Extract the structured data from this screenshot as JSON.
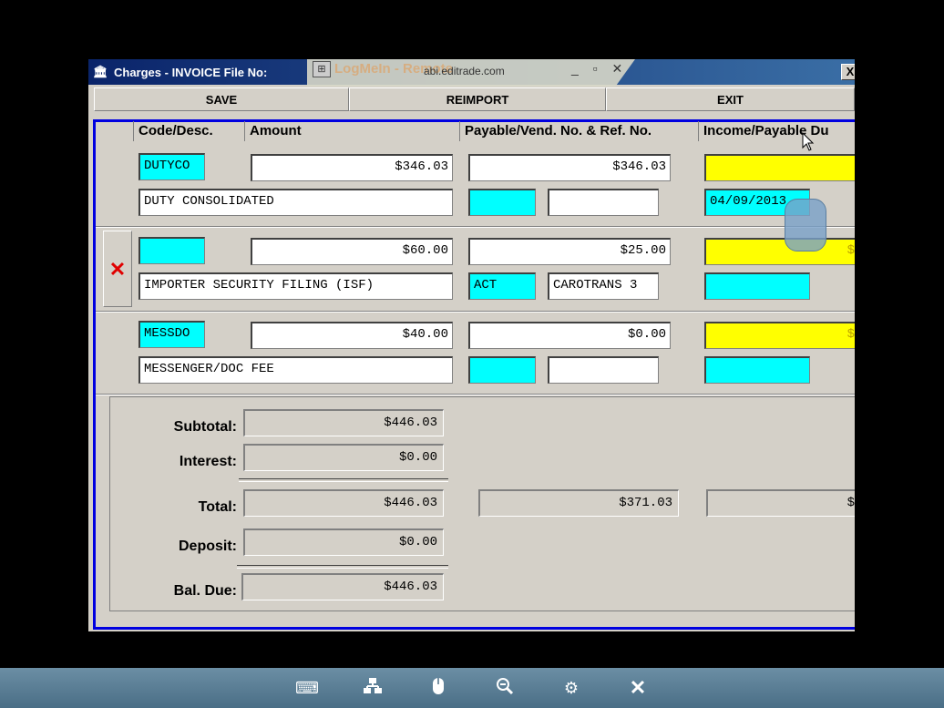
{
  "window": {
    "title": "Charges - INVOICE  File No:",
    "close": "X"
  },
  "remote_overlay": {
    "brand": "LogMeIn - Remote",
    "url": "abi.editrade.com",
    "controls": "_ ▫ ✕"
  },
  "toolbar": {
    "save": "SAVE",
    "reimport": "REIMPORT",
    "exit": "EXIT"
  },
  "columns": {
    "code": "Code/Desc.",
    "amount": "Amount",
    "payable": "Payable/Vend. No. & Ref. No.",
    "income": "Income/Payable Du"
  },
  "charges": [
    {
      "code": "DUTYCO",
      "amount": "$346.03",
      "payable": "$346.03",
      "desc": "DUTY CONSOLIDATED",
      "vendor": "",
      "ref": "",
      "due": "04/09/2013",
      "income": ""
    },
    {
      "code": "",
      "amount": "$60.00",
      "payable": "$25.00",
      "desc": "IMPORTER SECURITY FILING (ISF)",
      "vendor": "ACT",
      "ref": "CAROTRANS 3",
      "due": "",
      "income": "$"
    },
    {
      "code": "MESSDO",
      "amount": "$40.00",
      "payable": "$0.00",
      "desc": "MESSENGER/DOC FEE",
      "vendor": "",
      "ref": "",
      "due": "",
      "income": "$"
    }
  ],
  "delete_icon": "✕",
  "summary": {
    "subtotal_label": "Subtotal:",
    "subtotal": "$446.03",
    "interest_label": "Interest:",
    "interest": "$0.00",
    "total_label": "Total:",
    "total": "$446.03",
    "total_payable": "$371.03",
    "total_income": "$",
    "deposit_label": "Deposit:",
    "deposit": "$0.00",
    "baldue_label": "Bal. Due:",
    "baldue": "$446.03"
  },
  "bottom_bar": {
    "icons": [
      "keyboard-icon",
      "network-icon",
      "mouse-icon",
      "zoom-icon",
      "settings-icon",
      "close-icon"
    ]
  }
}
